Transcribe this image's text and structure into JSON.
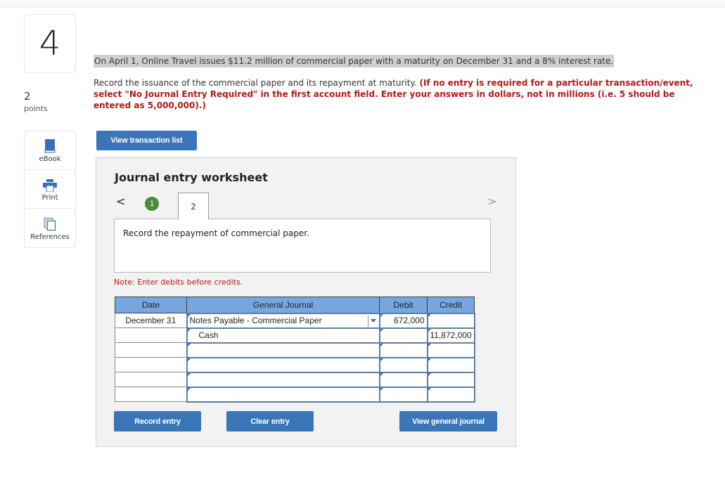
{
  "question": {
    "number": "4",
    "points_value": "2",
    "points_label": "points",
    "scenario": "On April 1, Online Travel issues $11.2 million of commercial paper with a maturity on December 31 and a 8% interest rate.",
    "instruction": "Record the issuance of the commercial paper and its repayment at maturity.",
    "instruction_emphasis": "(If no entry is required for a particular transaction/event, select \"No Journal Entry Required\" in the first account field. Enter your answers in dollars, not in millions (i.e. 5 should be entered as 5,000,000).)"
  },
  "tools": [
    {
      "label": "eBook",
      "icon": "book-icon"
    },
    {
      "label": "Print",
      "icon": "printer-icon"
    },
    {
      "label": "References",
      "icon": "documents-icon"
    }
  ],
  "buttons": {
    "view_transaction_list": "View transaction list",
    "record_entry": "Record entry",
    "clear_entry": "Clear entry",
    "view_general_journal": "View general journal"
  },
  "worksheet": {
    "title": "Journal entry worksheet",
    "nav_prev": "<",
    "nav_next": ">",
    "steps": [
      {
        "label": "1",
        "status": "completed"
      },
      {
        "label": "2",
        "status": "active"
      }
    ],
    "description": "Record the repayment of commercial paper.",
    "note": "Note: Enter debits before credits."
  },
  "journal": {
    "headers": [
      "Date",
      "General Journal",
      "Debit",
      "Credit"
    ],
    "rows": [
      {
        "date": "December 31",
        "account": "Notes Payable - Commercial Paper",
        "debit": "672,000",
        "credit": ""
      },
      {
        "date": "",
        "account": "Cash",
        "debit": "",
        "credit": "11,872,000"
      },
      {
        "date": "",
        "account": "",
        "debit": "",
        "credit": ""
      },
      {
        "date": "",
        "account": "",
        "debit": "",
        "credit": ""
      },
      {
        "date": "",
        "account": "",
        "debit": "",
        "credit": ""
      },
      {
        "date": "",
        "account": "",
        "debit": "",
        "credit": ""
      }
    ]
  }
}
